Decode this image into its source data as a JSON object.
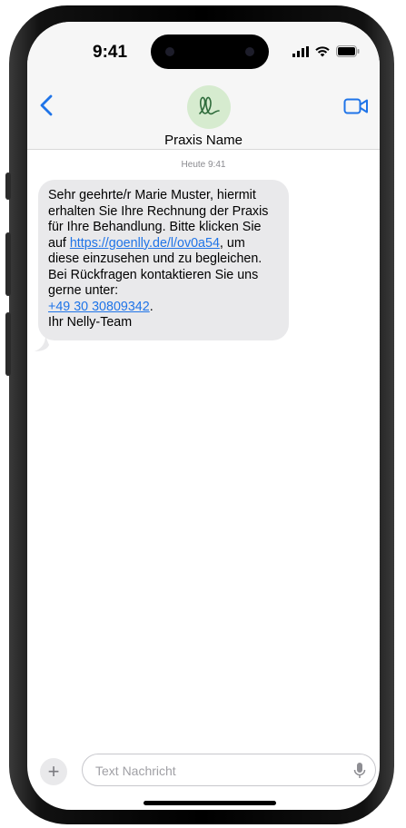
{
  "status_bar": {
    "time": "9:41"
  },
  "header": {
    "contact_name": "Praxis Name"
  },
  "conversation": {
    "timestamp": "Heute 9:41",
    "message": {
      "text_before_link": "Sehr geehrte/r Marie Muster, hiermit erhalten Sie Ihre Rechnung der Praxis für Ihre Behandlung. Bitte klicken Sie auf ",
      "link_text": "https://goenlly.de/l/ov0a54",
      "text_after_link": ", um diese einzusehen und zu begleichen. Bei Rückfragen kontaktieren Sie uns gerne unter: ",
      "phone": "+49 30 30809342",
      "text_after_phone": ".",
      "signature": "Ihr Nelly-Team"
    }
  },
  "composer": {
    "placeholder": "Text Nachricht",
    "value": ""
  },
  "icons": {
    "back": "chevron-left-icon",
    "avatar": "nelly-logo",
    "video": "video-camera-icon",
    "add": "plus-icon",
    "mic": "microphone-icon"
  },
  "colors": {
    "accent": "#1f74e8",
    "bubble": "#e9e9eb",
    "avatar_bg": "#d6ebcf"
  }
}
